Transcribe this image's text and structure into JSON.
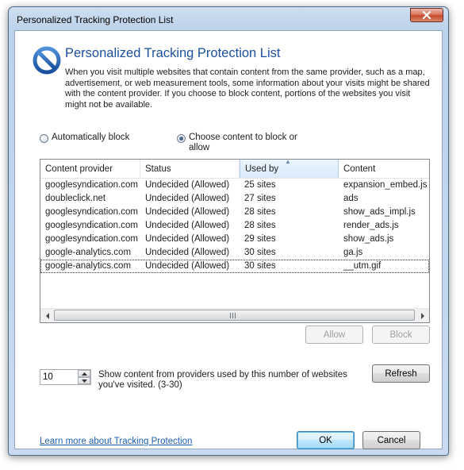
{
  "window": {
    "title": "Personalized Tracking Protection List"
  },
  "header": {
    "title": "Personalized Tracking Protection List",
    "description": "When you visit multiple websites that contain content from the same provider, such as a map, advertisement, or web measurement tools, some information about your visits might be shared with the content provider.  If you choose to block content, portions of the websites you visit might not be available.",
    "icon": "blocked-circle-icon"
  },
  "mode": {
    "auto_label": "Automatically block",
    "auto_checked": false,
    "choose_label": "Choose content to block or allow",
    "choose_checked": true
  },
  "table": {
    "columns": [
      "Content provider",
      "Status",
      "Used by",
      "Content"
    ],
    "sorted_column": "Used by",
    "sort_direction": "ascending",
    "rows": [
      [
        "googlesyndication.com",
        "Undecided (Allowed)",
        "25 sites",
        "expansion_embed.js"
      ],
      [
        "doubleclick.net",
        "Undecided (Allowed)",
        "27 sites",
        "ads"
      ],
      [
        "googlesyndication.com",
        "Undecided (Allowed)",
        "28 sites",
        "show_ads_impl.js"
      ],
      [
        "googlesyndication.com",
        "Undecided (Allowed)",
        "28 sites",
        "render_ads.js"
      ],
      [
        "googlesyndication.com",
        "Undecided (Allowed)",
        "29 sites",
        "show_ads.js"
      ],
      [
        "google-analytics.com",
        "Undecided (Allowed)",
        "30 sites",
        "ga.js"
      ],
      [
        "google-analytics.com",
        "Undecided (Allowed)",
        "30 sites",
        "__utm.gif"
      ]
    ],
    "focused_row": 6
  },
  "actions": {
    "allow_label": "Allow",
    "block_label": "Block"
  },
  "threshold": {
    "value": "10",
    "label": "Show content from providers used by this number of websites you've visited. (3-30)",
    "refresh_label": "Refresh"
  },
  "footer": {
    "learn_more": "Learn more about Tracking Protection",
    "ok_label": "OK",
    "cancel_label": "Cancel"
  },
  "colors": {
    "accent_title": "#1c4f9c",
    "link": "#1a5fb4",
    "block_icon": "#1f5fae"
  }
}
